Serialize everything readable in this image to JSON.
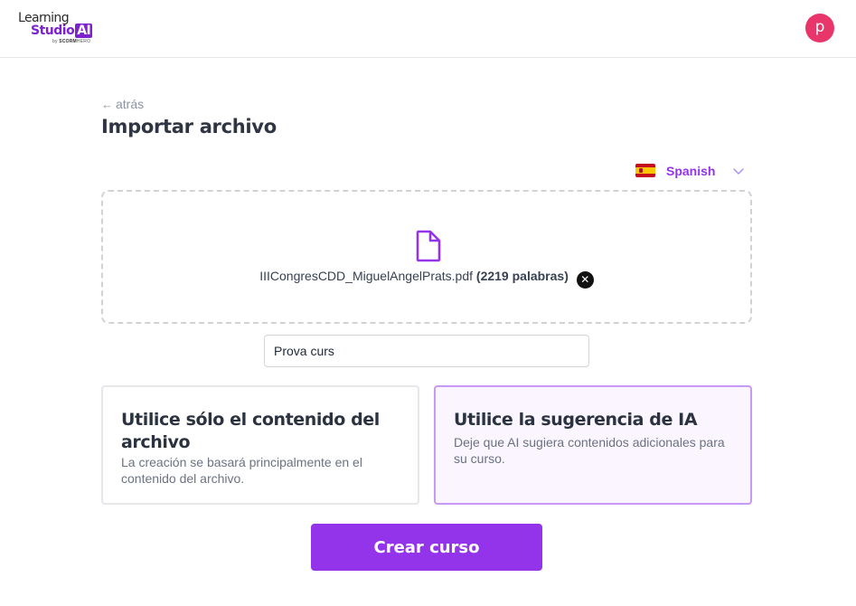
{
  "header": {
    "logo": {
      "line1": "Learning",
      "line2": "Studio",
      "line2_badge": "AI",
      "line3_prefix": "by",
      "line3_brand": "SCORM",
      "line3_suffix": "HERO"
    },
    "avatar_initial": "p"
  },
  "nav": {
    "back_label": "atrás"
  },
  "page": {
    "title": "Importar archivo"
  },
  "language": {
    "selected": "Spanish",
    "flag": "spain-flag-icon"
  },
  "upload": {
    "file_name": "IIICongresCDD_MiguelAngelPrats.pdf",
    "word_count": "(2219 palabras)",
    "remove_glyph": "✕",
    "icon": "document-icon"
  },
  "course_name": {
    "value": "Prova curs",
    "placeholder": ""
  },
  "options": [
    {
      "title": "Utilice sólo el contenido del archivo",
      "description": "La creación se basará principalmente en el contenido del archivo.",
      "selected": false
    },
    {
      "title": "Utilice la sugerencia de IA",
      "description": "Deje que AI sugiera contenidos adicionales para su curso.",
      "selected": true
    }
  ],
  "actions": {
    "create_label": "Crear curso"
  },
  "colors": {
    "accent": "#9333ea",
    "avatar": "#e8366b",
    "selected_border": "#c89af3",
    "selected_bg": "#faf5ff"
  }
}
